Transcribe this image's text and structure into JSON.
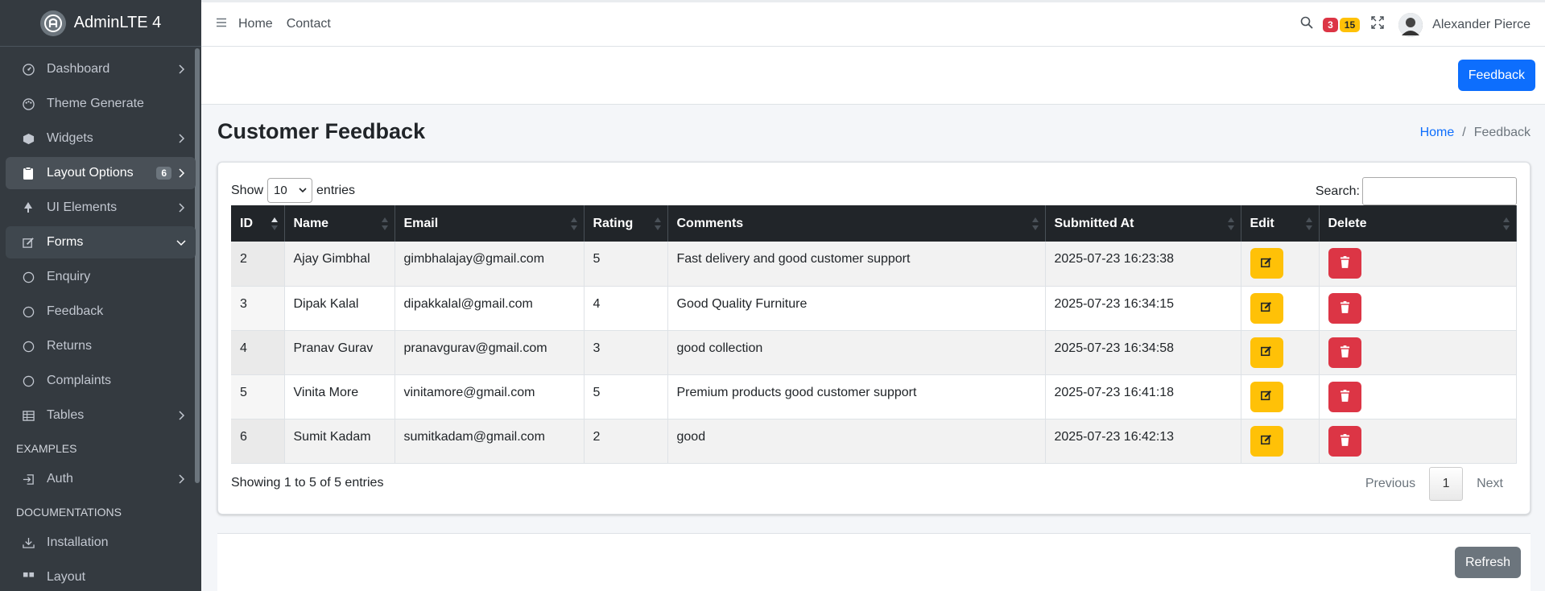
{
  "brand": {
    "name": "AdminLTE 4"
  },
  "sidebar": {
    "items": [
      {
        "label": "Dashboard",
        "icon": "speedometer-icon"
      },
      {
        "label": "Theme Generate",
        "icon": "palette-icon"
      },
      {
        "label": "Widgets",
        "icon": "box-icon"
      },
      {
        "label": "Layout Options",
        "icon": "clipboard-icon",
        "badge": "6"
      },
      {
        "label": "UI Elements",
        "icon": "tree-icon"
      },
      {
        "label": "Forms",
        "icon": "pencil-square-icon"
      },
      {
        "label": "Enquiry",
        "icon": "circle-icon"
      },
      {
        "label": "Feedback",
        "icon": "circle-icon"
      },
      {
        "label": "Returns",
        "icon": "circle-icon"
      },
      {
        "label": "Complaints",
        "icon": "circle-icon"
      },
      {
        "label": "Tables",
        "icon": "table-icon"
      }
    ],
    "header_examples": "EXAMPLES",
    "auth": {
      "label": "Auth",
      "icon": "box-arrow-in-right-icon"
    },
    "header_docs": "DOCUMENTATIONS",
    "installation": {
      "label": "Installation",
      "icon": "download-icon"
    },
    "layout": {
      "label": "Layout",
      "icon": "grid-icon"
    }
  },
  "topbar": {
    "links": [
      "Home",
      "Contact"
    ],
    "messages_count": "3",
    "notifications_count": "15",
    "user_name": "Alexander Pierce"
  },
  "actions": {
    "feedback_label": "Feedback",
    "refresh_label": "Refresh"
  },
  "page": {
    "title": "Customer Feedback",
    "breadcrumb_home": "Home",
    "breadcrumb_sep": "/",
    "breadcrumb_current": "Feedback"
  },
  "table_controls": {
    "show_label": "Show",
    "entries_value": "10",
    "entries_label": "entries",
    "search_label": "Search:",
    "info": "Showing 1 to 5 of 5 entries",
    "previous": "Previous",
    "current_page": "1",
    "next": "Next"
  },
  "table": {
    "columns": [
      "ID",
      "Name",
      "Email",
      "Rating",
      "Comments",
      "Submitted At",
      "Edit",
      "Delete"
    ],
    "rows": [
      {
        "id": "2",
        "name": "Ajay Gimbhal",
        "email": "gimbhalajay@gmail.com",
        "rating": "5",
        "comments": "Fast delivery and good customer support",
        "submitted": "2025-07-23 16:23:38"
      },
      {
        "id": "3",
        "name": "Dipak Kalal",
        "email": "dipakkalal@gmail.com",
        "rating": "4",
        "comments": "Good Quality Furniture",
        "submitted": "2025-07-23 16:34:15"
      },
      {
        "id": "4",
        "name": "Pranav Gurav",
        "email": "pranavgurav@gmail.com",
        "rating": "3",
        "comments": "good collection",
        "submitted": "2025-07-23 16:34:58"
      },
      {
        "id": "5",
        "name": "Vinita More",
        "email": "vinitamore@gmail.com",
        "rating": "5",
        "comments": "Premium products good customer support",
        "submitted": "2025-07-23 16:41:18"
      },
      {
        "id": "6",
        "name": "Sumit Kadam",
        "email": "sumitkadam@gmail.com",
        "rating": "2",
        "comments": "good",
        "submitted": "2025-07-23 16:42:13"
      }
    ]
  },
  "colors": {
    "primary": "#0d6efd",
    "warning": "#ffc107",
    "danger": "#dc3545",
    "secondary": "#6c757d",
    "sidebar_bg": "#343a40"
  }
}
